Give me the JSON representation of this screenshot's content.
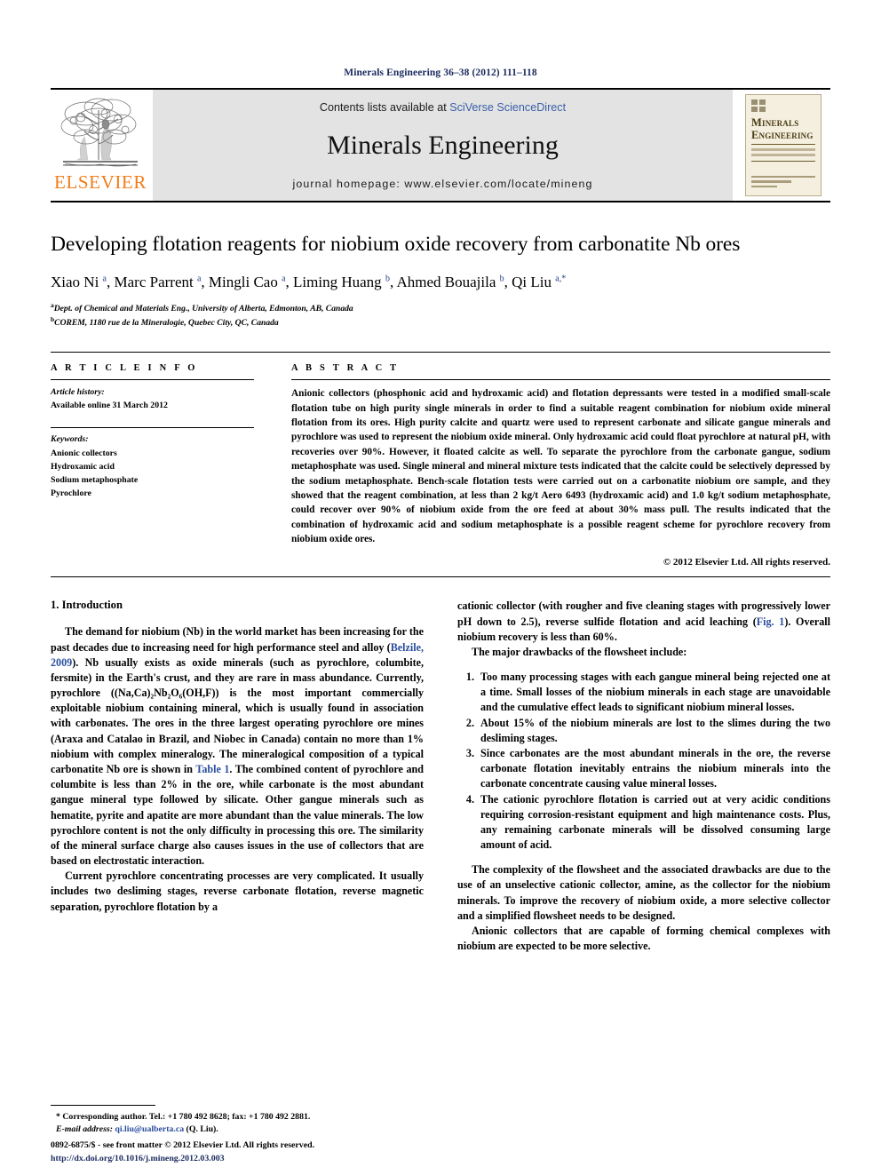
{
  "running_head": "Minerals Engineering 36–38 (2012) 111–118",
  "journal_header": {
    "contents_prefix": "Contents lists available at ",
    "sciencedirect": "SciVerse ScienceDirect",
    "journal_name": "Minerals Engineering",
    "homepage": "journal homepage: www.elsevier.com/locate/mineng",
    "publisher_logo_text": "ELSEVIER",
    "cover_title_line1": "Minerals",
    "cover_title_line2": "Engineering"
  },
  "article": {
    "title": "Developing flotation reagents for niobium oxide recovery from carbonatite Nb ores",
    "authors_html": "Xiao Ni <sup>a</sup>, Marc Parrent <sup>a</sup>, Mingli Cao <sup>a</sup>, Liming Huang <sup>b</sup>, Ahmed Bouajila <sup>b</sup>, Qi Liu <sup>a,*</sup>",
    "affiliations": [
      "Dept. of Chemical and Materials Eng., University of Alberta, Edmonton, AB, Canada",
      "COREM, 1180 rue de la Mineralogie, Quebec City, QC, Canada"
    ],
    "affiliation_marks": [
      "a",
      "b"
    ]
  },
  "article_info": {
    "heading": "A R T I C L E    I N F O",
    "history_label": "Article history:",
    "history_value": "Available online 31 March 2012",
    "keywords_label": "Keywords:",
    "keywords": [
      "Anionic collectors",
      "Hydroxamic acid",
      "Sodium metaphosphate",
      "Pyrochlore"
    ]
  },
  "abstract": {
    "heading": "A B S T R A C T",
    "text": "Anionic collectors (phosphonic acid and hydroxamic acid) and flotation depressants were tested in a modified small-scale flotation tube on high purity single minerals in order to find a suitable reagent combination for niobium oxide mineral flotation from its ores. High purity calcite and quartz were used to represent carbonate and silicate gangue minerals and pyrochlore was used to represent the niobium oxide mineral. Only hydroxamic acid could float pyrochlore at natural pH, with recoveries over 90%. However, it floated calcite as well. To separate the pyrochlore from the carbonate gangue, sodium metaphosphate was used. Single mineral and mineral mixture tests indicated that the calcite could be selectively depressed by the sodium metaphosphate. Bench-scale flotation tests were carried out on a carbonatite niobium ore sample, and they showed that the reagent combination, at less than 2 kg/t Aero 6493 (hydroxamic acid) and 1.0 kg/t sodium metaphosphate, could recover over 90% of niobium oxide from the ore feed at about 30% mass pull. The results indicated that the combination of hydroxamic acid and sodium metaphosphate is a possible reagent scheme for pyrochlore recovery from niobium oxide ores.",
    "copyright": "© 2012 Elsevier Ltd. All rights reserved."
  },
  "introduction": {
    "heading": "1. Introduction",
    "para1_a": "The demand for niobium (Nb) in the world market has been increasing for the past decades due to increasing need for high performance steel and alloy (",
    "para1_ref1": "Belzile, 2009",
    "para1_b": "). Nb usually exists as oxide minerals (such as pyrochlore, columbite, fersmite) in the Earth's crust, and they are rare in mass abundance. Currently, pyrochlore ((Na,Ca)₂Nb₂O₆(OH,F)) is the most important commercially exploitable niobium containing mineral, which is usually found in association with carbonates. The ores in the three largest operating pyrochlore ore mines (Araxa and Catalao in Brazil, and Niobec in Canada) contain no more than 1% niobium with complex mineralogy. The mineralogical composition of a typical carbonatite Nb ore is shown in ",
    "para1_ref2": "Table 1",
    "para1_c": ". The combined content of pyrochlore and columbite is less than 2% in the ore, while carbonate is the most abundant gangue mineral type followed by silicate. Other gangue minerals such as hematite, pyrite and apatite are more abundant than the value minerals. The low pyrochlore content is not the only difficulty in processing this ore. The similarity of the mineral surface charge also causes issues in the use of collectors that are based on electrostatic interaction.",
    "para2_a": "Current pyrochlore concentrating processes are very complicated. It usually includes two desliming stages, reverse carbonate flotation, reverse magnetic separation, pyrochlore flotation by a cationic collector (with rougher and five cleaning stages with progressively lower pH down to 2.5), reverse sulfide flotation and acid leaching (",
    "para2_ref1": "Fig. 1",
    "para2_b": "). Overall niobium recovery is less than 60%.",
    "para3": "The major drawbacks of the flowsheet include:",
    "drawbacks": [
      "Too many processing stages with each gangue mineral being rejected one at a time. Small losses of the niobium minerals in each stage are unavoidable and the cumulative effect leads to significant niobium mineral losses.",
      "About 15% of the niobium minerals are lost to the slimes during the two desliming stages.",
      "Since carbonates are the most abundant minerals in the ore, the reverse carbonate flotation inevitably entrains the niobium minerals into the carbonate concentrate causing value mineral losses.",
      "The cationic pyrochlore flotation is carried out at very acidic conditions requiring corrosion-resistant equipment and high maintenance costs. Plus, any remaining carbonate minerals will be dissolved consuming large amount of acid."
    ],
    "para4": "The complexity of the flowsheet and the associated drawbacks are due to the use of an unselective cationic collector, amine, as the collector for the niobium minerals. To improve the recovery of niobium oxide, a more selective collector and a simplified flowsheet needs to be designed.",
    "para5": "Anionic collectors that are capable of forming chemical complexes with niobium are expected to be more selective."
  },
  "footnotes": {
    "corresponding": "* Corresponding author. Tel.: +1 780 492 8628; fax: +1 780 492 2881.",
    "email_label": "E-mail address:",
    "email": "qi.liu@ualberta.ca",
    "email_suffix": " (Q. Liu).",
    "front_matter": "0892-6875/$ - see front matter © 2012 Elsevier Ltd. All rights reserved.",
    "doi": "http://dx.doi.org/10.1016/j.mineng.2012.03.003"
  },
  "colors": {
    "link": "#2b4f9e",
    "running_head": "#1a2a5e",
    "elsevier_orange": "#f07d1a",
    "band_gray": "#e3e3e3"
  }
}
